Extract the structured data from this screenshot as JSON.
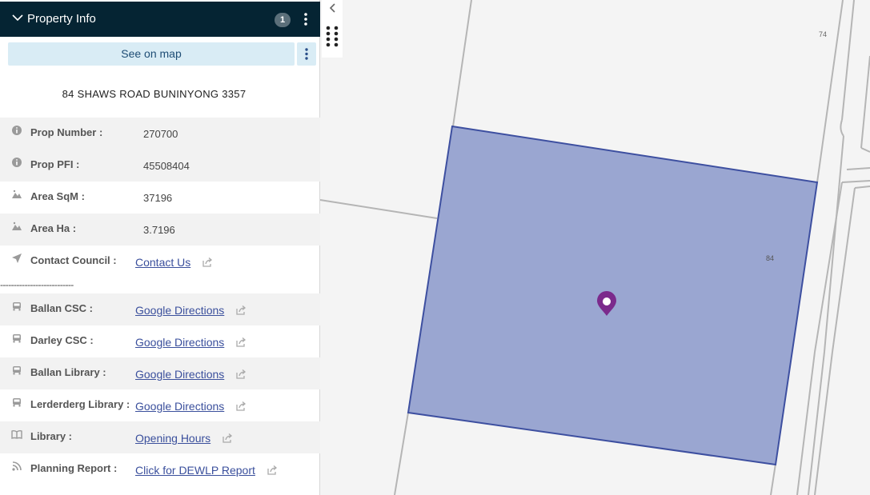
{
  "panel": {
    "title": "Property Info",
    "count": "1",
    "see_on_map": "See on map",
    "address": "84 SHAWS ROAD BUNINYONG 3357"
  },
  "info_rows": [
    {
      "label": "Prop Number :",
      "value": "270700",
      "icon": "info-icon"
    },
    {
      "label": "Prop PFI :",
      "value": "45508404",
      "icon": "info-icon"
    },
    {
      "label": "Area SqM :",
      "value": "37196",
      "icon": "mountain-icon"
    },
    {
      "label": "Area Ha :",
      "value": "3.7196",
      "icon": "mountain-icon"
    },
    {
      "label": "Contact Council :",
      "link": "Contact Us",
      "icon": "send-icon"
    }
  ],
  "divider": "---------------------------",
  "link_rows": [
    {
      "label": "Ballan CSC :",
      "link": "Google Directions",
      "icon": "car-icon"
    },
    {
      "label": "Darley CSC :",
      "link": "Google Directions",
      "icon": "car-icon"
    },
    {
      "label": "Ballan Library :",
      "link": "Google Directions",
      "icon": "car-icon"
    },
    {
      "label": "Lerderderg Library :",
      "link": "Google Directions",
      "icon": "car-icon"
    },
    {
      "label": "Library :",
      "link": "Opening Hours",
      "icon": "book-icon"
    },
    {
      "label": "Planning Report :",
      "link": "Click for DEWLP Report",
      "icon": "rss-icon"
    }
  ],
  "map": {
    "parcel_labels": [
      "74",
      "84"
    ],
    "parcel_fill": "#9aa6d1",
    "parcel_stroke": "#3d4fa0",
    "marker_color": "#7b2a8c"
  }
}
